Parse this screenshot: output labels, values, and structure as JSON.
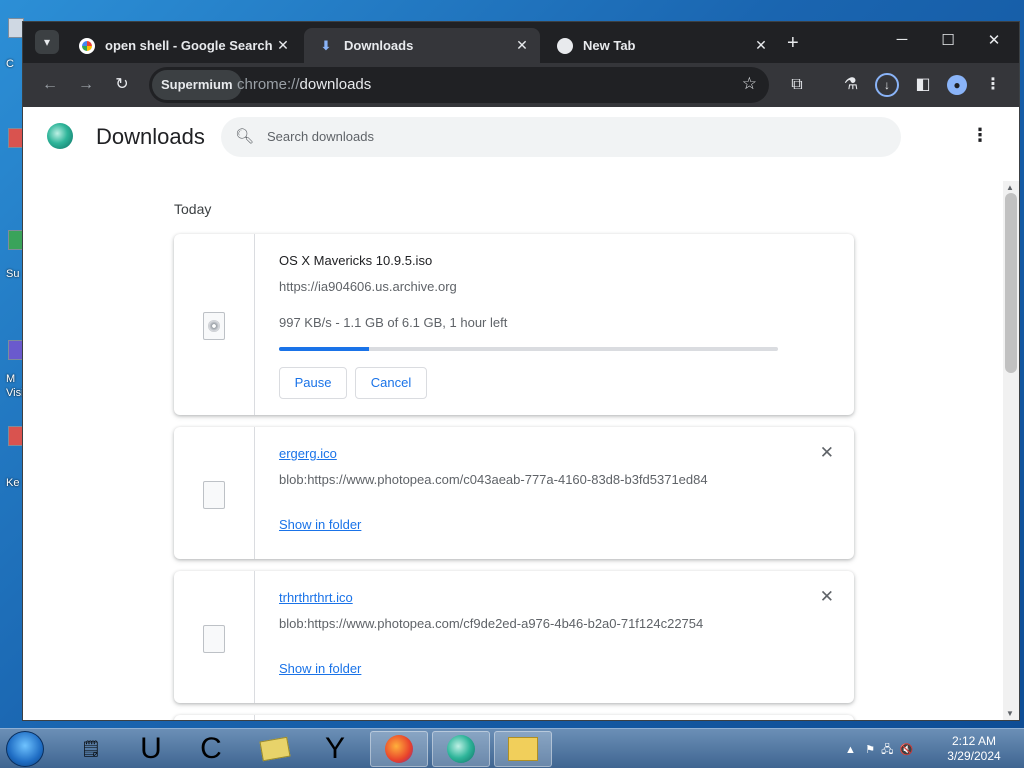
{
  "desktop": {
    "icon_labels": [
      "C",
      "Su",
      "M",
      "Visi",
      "Ke"
    ]
  },
  "browser": {
    "tabs": [
      {
        "title": "open shell - Google Search",
        "icon": "google-icon"
      },
      {
        "title": "Downloads",
        "icon": "download-icon"
      },
      {
        "title": "New Tab",
        "icon": "chromium-icon"
      }
    ],
    "toolbar": {
      "chip_label": "Supermium",
      "url_scheme": "chrome://",
      "url_host": "downloads"
    }
  },
  "downloads_page": {
    "title": "Downloads",
    "search_placeholder": "Search downloads",
    "section_title": "Today",
    "items": [
      {
        "name": "OS X Mavericks 10.9.5.iso",
        "source": "https://ia904606.us.archive.org",
        "status": "997 KB/s - 1.1 GB of 6.1 GB, 1 hour left",
        "progress_fraction": 0.18,
        "pause_label": "Pause",
        "cancel_label": "Cancel"
      },
      {
        "name": "ergerg.ico",
        "source": "blob:https://www.photopea.com/c043aeab-777a-4160-83d8-b3fd5371ed84",
        "action_label": "Show in folder"
      },
      {
        "name": "trhrthrthrt.ico",
        "source": "blob:https://www.photopea.com/cf9de2ed-a976-4b46-b2a0-71f124c22754",
        "action_label": "Show in folder"
      }
    ]
  },
  "taskbar": {
    "apps": [
      "U",
      "C",
      "Y"
    ],
    "clock_time": "2:12 AM",
    "clock_date": "3/29/2024"
  },
  "colors": {
    "accent": "#1a73e8",
    "chrome_dark": "#202124",
    "toolbar": "#35363a"
  }
}
